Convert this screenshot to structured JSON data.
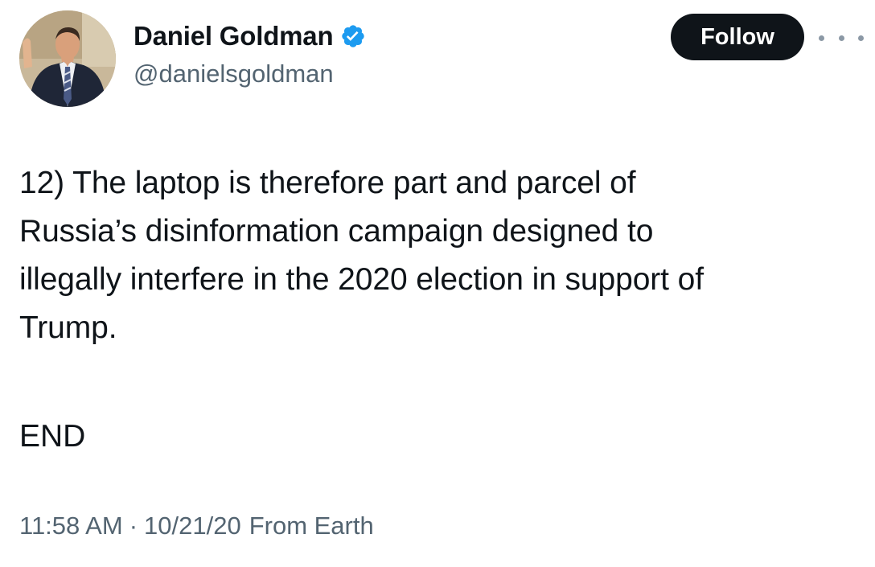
{
  "author": {
    "display_name": "Daniel Goldman",
    "handle": "@danielsgoldman",
    "verified": true,
    "verified_color": "#1d9bf0",
    "avatar_icon": "profile-photo"
  },
  "actions": {
    "follow_label": "Follow",
    "more_icon": "more-horizontal-icon"
  },
  "tweet": {
    "lines": [
      "12) The laptop is therefore part and parcel of",
      "Russia’s disinformation campaign designed to",
      "illegally interfere in the 2020 election in support of",
      "Trump."
    ],
    "closing": "END"
  },
  "meta": {
    "time": "11:58 AM",
    "separator": "·",
    "date": "10/21/20",
    "source": "From Earth"
  },
  "colors": {
    "text_primary": "#0f1419",
    "text_secondary": "#536471",
    "button_bg": "#0f1419",
    "button_text": "#ffffff"
  }
}
